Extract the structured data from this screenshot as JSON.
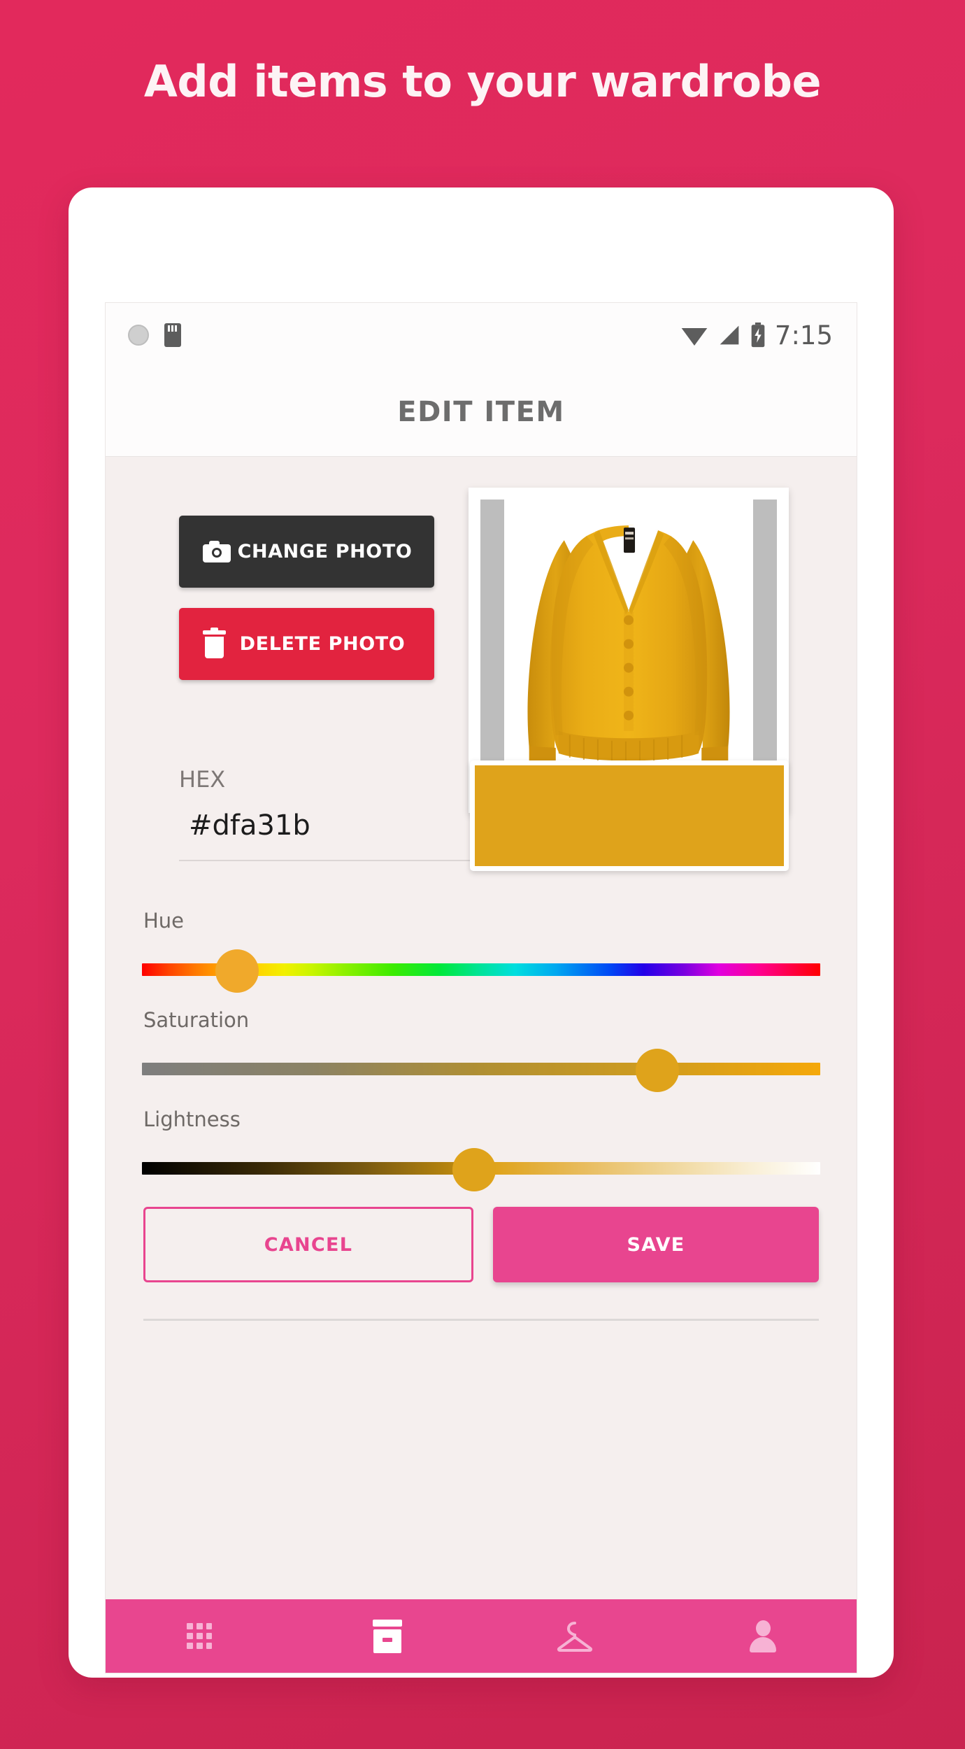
{
  "hero": {
    "title": "Add items to your wardrobe"
  },
  "status_bar": {
    "time": "7:15",
    "icons": [
      "disc-icon",
      "sdcard-icon",
      "wifi-icon",
      "signal-icon",
      "battery-charging-icon"
    ]
  },
  "app_bar": {
    "title": "EDIT ITEM"
  },
  "photo_section": {
    "change_photo_label": "CHANGE PHOTO",
    "change_photo_icon": "camera-icon",
    "delete_photo_label": "DELETE PHOTO",
    "delete_photo_icon": "trash-icon",
    "preview_alt": "yellow v-neck cardigan"
  },
  "color_section": {
    "hex_label": "HEX",
    "hex_value": "#dfa31b",
    "swatch_color": "#dfa31b"
  },
  "sliders": [
    {
      "name": "Hue",
      "position_pct": 14
    },
    {
      "name": "Saturation",
      "position_pct": 76
    },
    {
      "name": "Lightness",
      "position_pct": 49
    }
  ],
  "actions": {
    "cancel_label": "CANCEL",
    "save_label": "SAVE"
  },
  "bottom_nav": {
    "items": [
      {
        "icon": "grid-icon",
        "active": false
      },
      {
        "icon": "box-icon",
        "active": true
      },
      {
        "icon": "hanger-icon",
        "active": false
      },
      {
        "icon": "person-icon",
        "active": false
      }
    ]
  },
  "theme": {
    "background_pink": "#e2295c",
    "accent_pink": "#e8468f",
    "danger_red": "#e2233f",
    "dark": "#333333",
    "item_color": "#dfa31b"
  }
}
